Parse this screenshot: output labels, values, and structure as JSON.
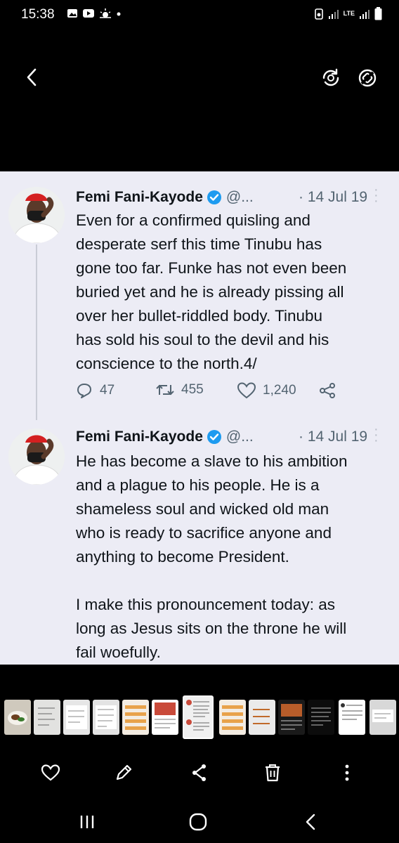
{
  "status_bar": {
    "time": "15:38",
    "left_icons": [
      "gallery-notification-icon",
      "youtube-icon",
      "weather-icon",
      "dot-icon"
    ],
    "network": "LTE",
    "right_icons": [
      "recycle-icon",
      "signal-icon",
      "lte-icon",
      "signal-icon",
      "battery-icon"
    ]
  },
  "viewer_toolbar": {
    "icons": [
      "back-arrow-icon",
      "remaster-icon",
      "auto-rotate-icon"
    ]
  },
  "tweets": [
    {
      "author": "Femi Fani-Kayode",
      "handle": "@...",
      "date": "· 14 Jul 19",
      "text": "Even for a confirmed quisling and\ndesperate serf this time Tinubu has\ngone too far. Funke has not even been\nburied yet and he is already pissing all\nover her bullet-riddled body. Tinubu\nhas sold his soul to the devil and his\nconscience to the north.4/",
      "replies": "47",
      "retweets": "455",
      "likes": "1,240"
    },
    {
      "author": "Femi Fani-Kayode",
      "handle": "@...",
      "date": "· 14 Jul 19",
      "text": "He has become a slave to his ambition\nand a plague to his people. He is a\nshameless soul and wicked old man\nwho is ready to sacrifice anyone and\nanything to become President.\n\nI make this pronouncement today: as\nlong as Jesus sits on the throne he will\nfail woefully."
    }
  ],
  "thumbnail_count": 13,
  "selected_thumbnail_index": 6,
  "bottom_actions": [
    "heart-icon",
    "edit-icon",
    "share-icon",
    "trash-icon",
    "more-vertical-icon"
  ],
  "nav_buttons": [
    "recent-apps-icon",
    "home-icon",
    "back-icon"
  ],
  "colors": {
    "card_bg": "#ececf5",
    "text_primary": "#0f1419",
    "text_secondary": "#536471",
    "verified_blue": "#1d9bf0"
  }
}
